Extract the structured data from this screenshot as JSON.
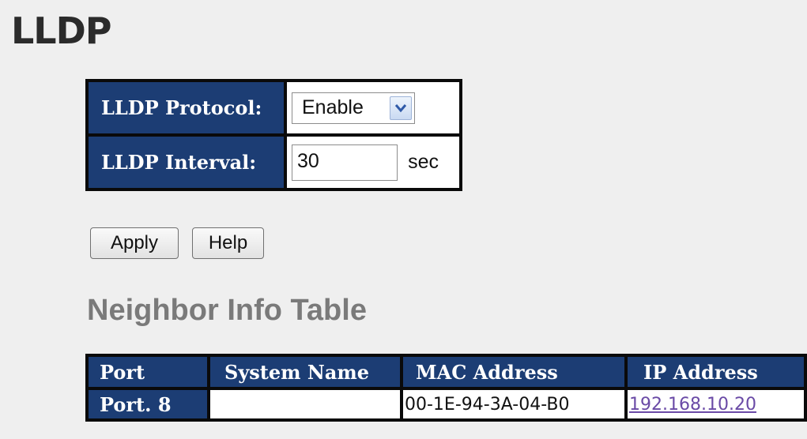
{
  "page": {
    "title": "LLDP"
  },
  "config": {
    "protocol_label": "LLDP Protocol:",
    "protocol_value": "Enable",
    "interval_label": "LLDP Interval:",
    "interval_value": "30",
    "interval_unit": "sec"
  },
  "buttons": {
    "apply_label": "Apply",
    "help_label": "Help"
  },
  "neighbor_table": {
    "title": "Neighbor Info Table",
    "headers": [
      "Port",
      "System Name",
      "MAC Address",
      "IP Address"
    ],
    "rows": [
      {
        "port": "Port. 8",
        "system_name": "",
        "mac_address": "00-1E-94-3A-04-B0",
        "ip_address": "192.168.10.20"
      }
    ]
  },
  "colors": {
    "header_bg": "#1c3d74",
    "border": "#0a0a0a",
    "link": "#6a4aa6",
    "background": "#efefef"
  }
}
